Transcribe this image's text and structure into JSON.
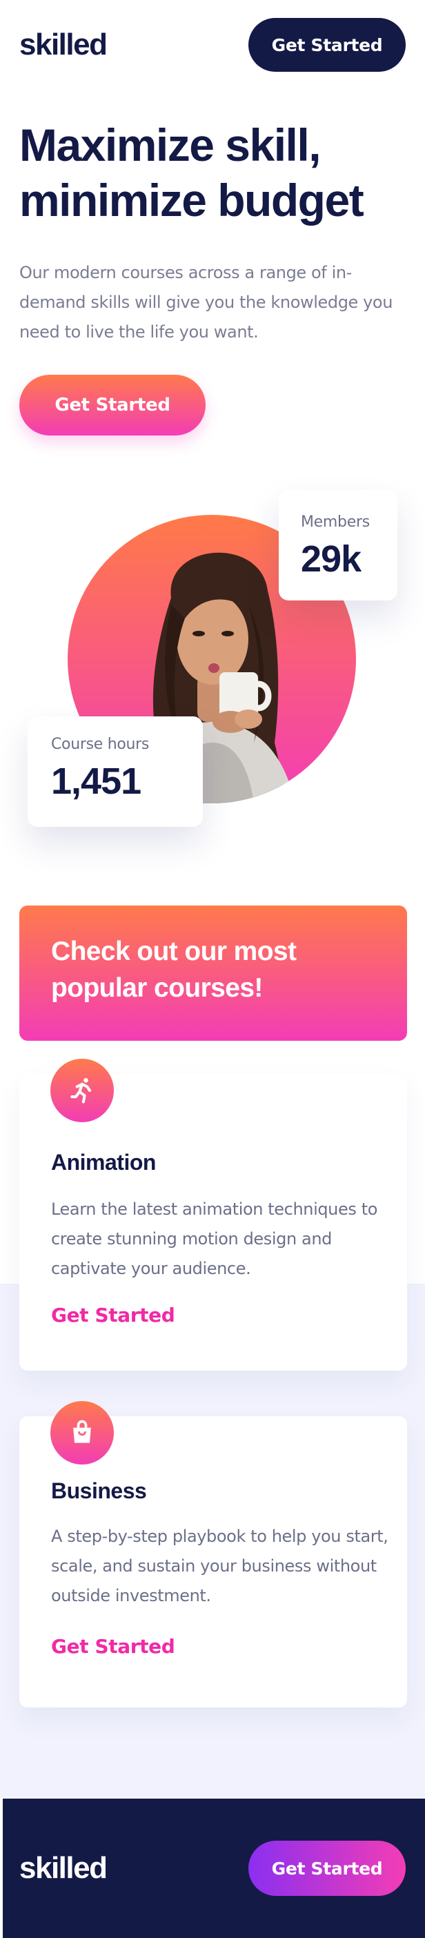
{
  "brand": {
    "logo_text": "skilled"
  },
  "header": {
    "cta_label": "Get Started"
  },
  "hero": {
    "title_line1": "Maximize skill,",
    "title_line2": "minimize budget",
    "description": "Our modern courses across a range of in-demand skills will give you the knowledge you need to live the life you want.",
    "cta_label": "Get Started",
    "image_alt": "woman sipping from a mug"
  },
  "stats": {
    "members": {
      "label": "Members",
      "value": "29k"
    },
    "course_hours": {
      "label": "Course hours",
      "value": "1,451"
    }
  },
  "courses": {
    "banner_line1": "Check out our most",
    "banner_line2": "popular courses!",
    "items": [
      {
        "icon": "running-person-icon",
        "title": "Animation",
        "description": "Learn the latest animation techniques to create stunning motion design and captivate your audience.",
        "link_label": "Get Started"
      },
      {
        "icon": "shopping-bag-icon",
        "title": "Business",
        "description": "A step-by-step playbook to help you start, scale, and sustain your business without outside investment.",
        "link_label": "Get Started"
      }
    ]
  },
  "footer": {
    "logo_text": "skilled",
    "cta_label": "Get Started"
  },
  "colors": {
    "navy": "#141a46",
    "gradient_start": "#ff7a4c",
    "gradient_end": "#f33db5",
    "link_pink": "#f02aa6",
    "section_bg": "#f1f2fd",
    "footer_button_start": "#8b2ff0"
  }
}
